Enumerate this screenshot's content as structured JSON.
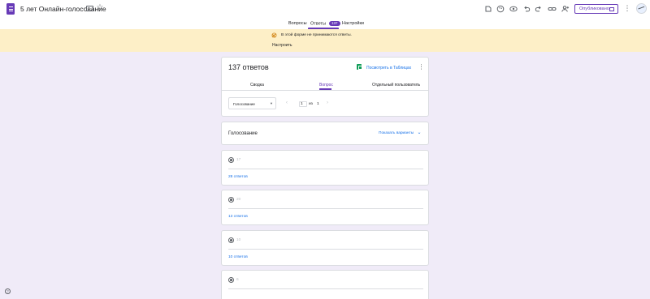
{
  "header": {
    "title": "5 лет Онлайн-голосование",
    "publish_label": "Опубликовано",
    "icons": [
      "forms-doc-icon",
      "folder-icon",
      "star-icon",
      "addon-icon",
      "palette-icon",
      "preview-icon",
      "undo-icon",
      "redo-icon",
      "link-icon",
      "add-person-icon",
      "more-vert-icon",
      "avatar"
    ]
  },
  "tabs": [
    {
      "label": "Вопросы"
    },
    {
      "label": "Ответы",
      "badge": "137"
    },
    {
      "label": "Настройки"
    }
  ],
  "banner": {
    "text": "В этой форме не принимаются ответы.",
    "action": "Настроить"
  },
  "summary": {
    "count_label": "137 ответов",
    "sheets_label": "Посмотреть в Таблицах",
    "views": [
      "Сводка",
      "Вопрос",
      "Отдельный пользователь"
    ],
    "active_view": "Вопрос",
    "question_select": "Голосование",
    "pager": {
      "current": "1",
      "of_label": "из",
      "total": "1"
    }
  },
  "question": {
    "title": "Голосование",
    "show_variants_label": "Показать варианты"
  },
  "options": [
    {
      "label": "17",
      "count": "28 ответов"
    },
    {
      "label": "20",
      "count": "13 ответов"
    },
    {
      "label": "10",
      "count": "10 ответов"
    },
    {
      "label": "6",
      "count": ""
    }
  ],
  "colors": {
    "accent": "#673ab7",
    "link": "#1a73e8",
    "page_bg": "#f0ebf8",
    "banner_bg": "#fdefc7",
    "sheets_green": "#0f9d58"
  }
}
